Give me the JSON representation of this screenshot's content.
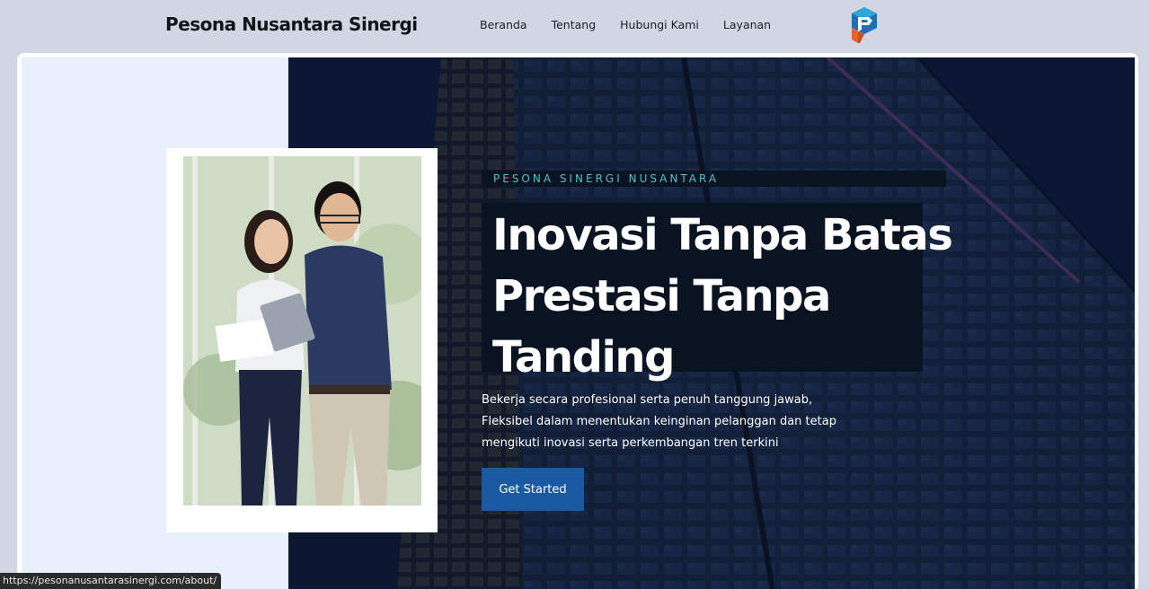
{
  "header": {
    "brand": "Pesona Nusantara Sinergi",
    "nav": [
      {
        "label": "Beranda"
      },
      {
        "label": "Tentang"
      },
      {
        "label": "Hubungi Kami"
      },
      {
        "label": "Layanan"
      }
    ],
    "logo_icon": "pns-logo-icon"
  },
  "hero": {
    "eyebrow": "PESONA SINERGI NUSANTARA",
    "headline_lines": [
      "Inovasi Tanpa Batas",
      "Prestasi Tanpa",
      "Tanding"
    ],
    "lead_lines": [
      "Bekerja secara profesional serta penuh tanggung jawab,",
      "Fleksibel dalam menentukan keinginan pelanggan dan tetap",
      "mengikuti inovasi serta perkembangan tren terkini"
    ],
    "cta_label": "Get Started",
    "photo_icon": "business-people-photo",
    "background_icon": "office-building-photo"
  },
  "status_bar": {
    "url": "https://pesonanusantarasinergi.com/about/"
  },
  "colors": {
    "page_bg": "#d2d6e2",
    "hero_left_bg": "#e8f0fb",
    "hero_right_bg": "#101c3a",
    "eyebrow": "#4ac3c7",
    "text_box": "#0a1322",
    "cta_bg": "#1a5aa0"
  }
}
